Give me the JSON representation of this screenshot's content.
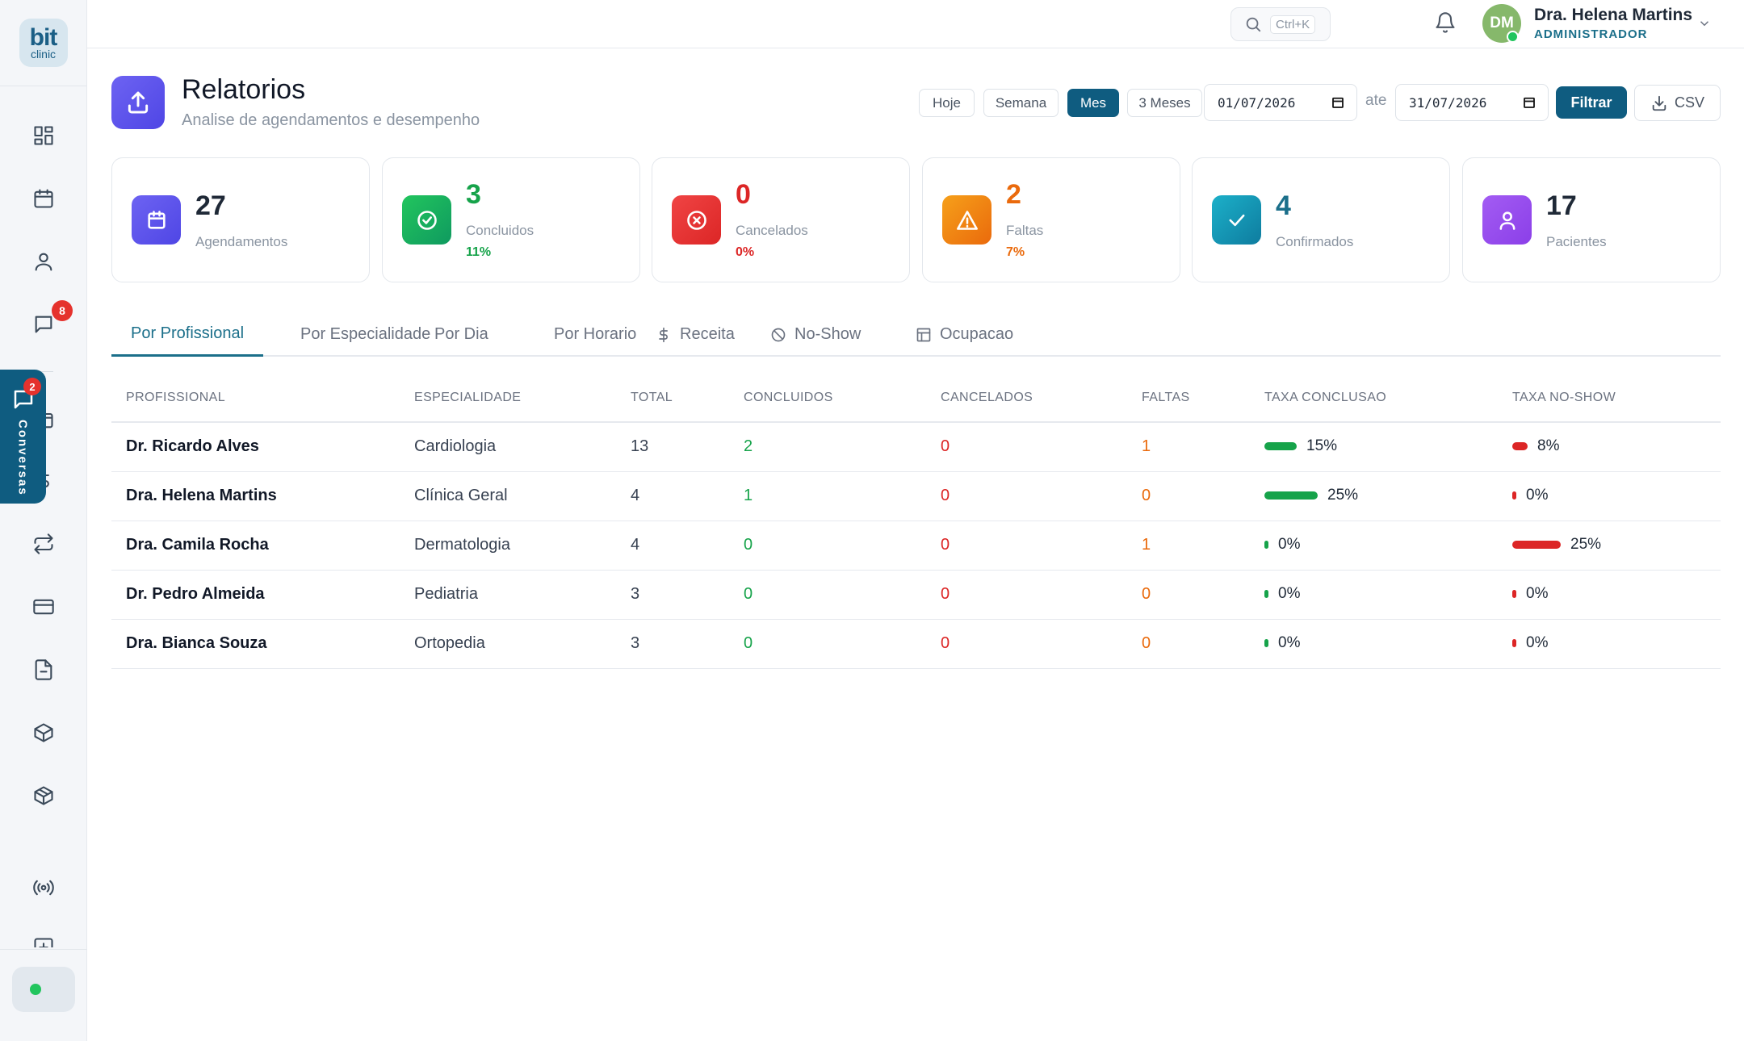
{
  "brand": {
    "logo_top": "bit",
    "logo_bottom": "clinic"
  },
  "sidebar": {
    "chat_badge": "8"
  },
  "conversas": {
    "label": "Conversas",
    "badge": "2"
  },
  "header": {
    "search_shortcut": "Ctrl+K",
    "user": {
      "initials": "DM",
      "name": "Dra. Helena Martins",
      "role": "ADMINISTRADOR"
    }
  },
  "page": {
    "title": "Relatorios",
    "subtitle": "Analise de agendamentos e desempenho"
  },
  "filters": {
    "periods": [
      {
        "label": "Hoje",
        "active": false
      },
      {
        "label": "Semana",
        "active": false
      },
      {
        "label": "Mes",
        "active": true
      },
      {
        "label": "3 Meses",
        "active": false
      }
    ],
    "start_date": "01/07/2026",
    "between_label": "ate",
    "end_date": "31/07/2026",
    "filter_button": "Filtrar",
    "export_button": "CSV"
  },
  "stats": [
    {
      "value": "27",
      "label": "Agendamentos",
      "pct": "",
      "color": "#1f2937",
      "icon": "calendar-icon"
    },
    {
      "value": "3",
      "label": "Concluidos",
      "pct": "11%",
      "color": "#16a34a",
      "icon": "check-circle-icon"
    },
    {
      "value": "0",
      "label": "Cancelados",
      "pct": "0%",
      "color": "#dc2626",
      "icon": "x-circle-icon"
    },
    {
      "value": "2",
      "label": "Faltas",
      "pct": "7%",
      "color": "#ea6a0c",
      "icon": "warning-icon"
    },
    {
      "value": "4",
      "label": "Confirmados",
      "pct": "",
      "color": "#1b6f8a",
      "icon": "check-icon"
    },
    {
      "value": "17",
      "label": "Pacientes",
      "pct": "",
      "color": "#1f2937",
      "icon": "user-icon"
    }
  ],
  "tabs": [
    {
      "label": "Por Profissional",
      "active": true,
      "icon": ""
    },
    {
      "label": "Por Especialidade",
      "active": false,
      "icon": ""
    },
    {
      "label": "Por Dia",
      "active": false,
      "icon": ""
    },
    {
      "label": "Por Horario",
      "active": false,
      "icon": ""
    },
    {
      "label": "Receita",
      "active": false,
      "icon": "dollar-icon"
    },
    {
      "label": "No-Show",
      "active": false,
      "icon": "ban-icon"
    },
    {
      "label": "Ocupacao",
      "active": false,
      "icon": "table-icon"
    }
  ],
  "table": {
    "columns": [
      "PROFISSIONAL",
      "ESPECIALIDADE",
      "TOTAL",
      "CONCLUIDOS",
      "CANCELADOS",
      "FALTAS",
      "TAXA CONCLUSAO",
      "TAXA NO-SHOW"
    ],
    "rows": [
      {
        "profissional": "Dr. Ricardo Alves",
        "especialidade": "Cardiologia",
        "total": "13",
        "concluidos": "2",
        "cancelados": "0",
        "faltas": "1",
        "taxa_conclusao": "15%",
        "conclusao_fraction": 0.15,
        "taxa_noshow": "8%",
        "noshow_fraction": 0.08
      },
      {
        "profissional": "Dra. Helena Martins",
        "especialidade": "Clínica Geral",
        "total": "4",
        "concluidos": "1",
        "cancelados": "0",
        "faltas": "0",
        "taxa_conclusao": "25%",
        "conclusao_fraction": 0.25,
        "taxa_noshow": "0%",
        "noshow_fraction": 0
      },
      {
        "profissional": "Dra. Camila Rocha",
        "especialidade": "Dermatologia",
        "total": "4",
        "concluidos": "0",
        "cancelados": "0",
        "faltas": "1",
        "taxa_conclusao": "0%",
        "conclusao_fraction": 0,
        "taxa_noshow": "25%",
        "noshow_fraction": 0.25
      },
      {
        "profissional": "Dr. Pedro Almeida",
        "especialidade": "Pediatria",
        "total": "3",
        "concluidos": "0",
        "cancelados": "0",
        "faltas": "0",
        "taxa_conclusao": "0%",
        "conclusao_fraction": 0,
        "taxa_noshow": "0%",
        "noshow_fraction": 0
      },
      {
        "profissional": "Dra. Bianca Souza",
        "especialidade": "Ortopedia",
        "total": "3",
        "concluidos": "0",
        "cancelados": "0",
        "faltas": "0",
        "taxa_conclusao": "0%",
        "conclusao_fraction": 0,
        "taxa_noshow": "0%",
        "noshow_fraction": 0
      }
    ]
  },
  "colors": {
    "primary": "#0f5c80",
    "success": "#16a34a",
    "danger": "#dc2626",
    "warning": "#ea6a0c"
  }
}
